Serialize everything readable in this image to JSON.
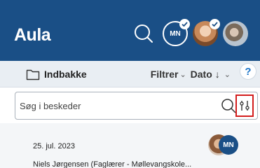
{
  "header": {
    "brand": "Aula",
    "profiles": [
      {
        "initials": "MN",
        "checked": true
      },
      {
        "checked": true
      },
      {
        "checked": false
      }
    ]
  },
  "toolbar": {
    "inbox_label": "Indbakke",
    "filter_label": "Filtrer",
    "sort_label": "Dato",
    "help_label": "?"
  },
  "search": {
    "placeholder": "Søg i beskeder"
  },
  "messages": [
    {
      "date": "25. jul. 2023",
      "sender": "Niels Jørgensen (Faglærer - Møllevangskole...",
      "avatar_initials": "MN"
    }
  ],
  "colors": {
    "header_bg": "#1a4f86",
    "toolbar_bg": "#e9eef3",
    "highlight_border": "#d31d1d",
    "help_accent": "#1a73c8"
  }
}
